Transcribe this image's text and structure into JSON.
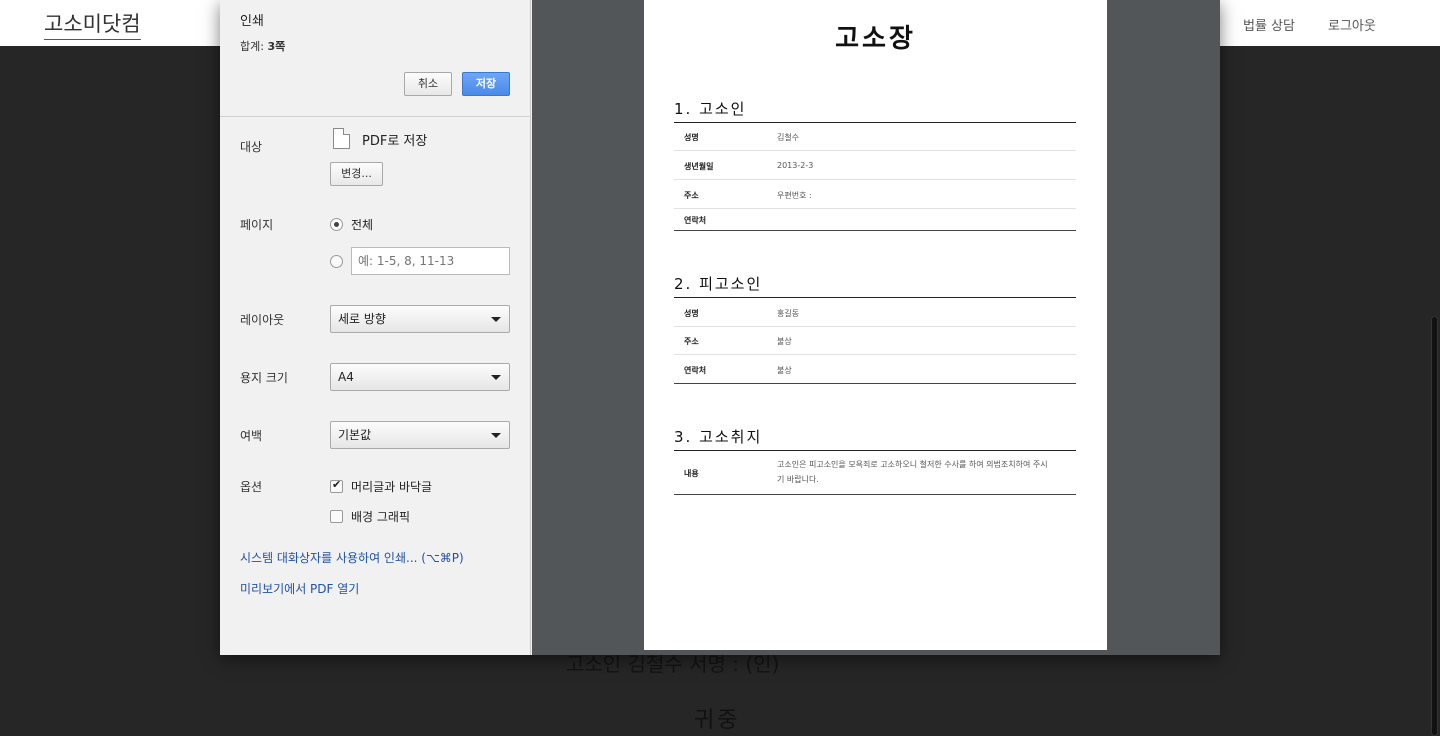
{
  "site": {
    "logo": "고소미닷컴",
    "nav": [
      "법률 상담",
      "로그아웃"
    ],
    "background_texts": [
      "고소인 김철수 서명 : (인)",
      "귀중"
    ]
  },
  "dialog": {
    "title": "인쇄",
    "total_label": "합계:",
    "total_value": "3쪽",
    "cancel_label": "취소",
    "save_label": "저장",
    "destination": {
      "label": "대상",
      "value": "PDF로 저장",
      "change_label": "변경..."
    },
    "pages": {
      "label": "페이지",
      "all_label": "전체",
      "range_placeholder": "예: 1-5, 8, 11-13"
    },
    "layout": {
      "label": "레이아웃",
      "value": "세로 방향"
    },
    "paper": {
      "label": "용지 크기",
      "value": "A4"
    },
    "margins": {
      "label": "여백",
      "value": "기본값"
    },
    "options": {
      "label": "옵션",
      "headers_label": "머리글과 바닥글",
      "headers_checked": true,
      "background_label": "배경 그래픽",
      "background_checked": false
    },
    "links": [
      "시스템 대화상자를 사용하여 인쇄... (⌥⌘P)",
      "미리보기에서 PDF 열기"
    ]
  },
  "document": {
    "title": "고소장",
    "sections": [
      {
        "title": "1. 고소인",
        "rows": [
          {
            "k": "성명",
            "v": "김철수"
          },
          {
            "k": "생년월일",
            "v": "2013-2-3"
          },
          {
            "k": "주소",
            "v": "우편번호 :"
          },
          {
            "k": "연락처",
            "v": ""
          }
        ]
      },
      {
        "title": "2. 피고소인",
        "rows": [
          {
            "k": "성명",
            "v": "홍길동"
          },
          {
            "k": "주소",
            "v": "불상"
          },
          {
            "k": "연락처",
            "v": "불상"
          }
        ]
      },
      {
        "title": "3. 고소취지",
        "rows": [
          {
            "k": "내용",
            "v": "고소인은 피고소인을 모욕죄로 고소하오니 철저한 수사를 하여 의법조치하여 주시기 바랍니다."
          }
        ]
      }
    ]
  }
}
